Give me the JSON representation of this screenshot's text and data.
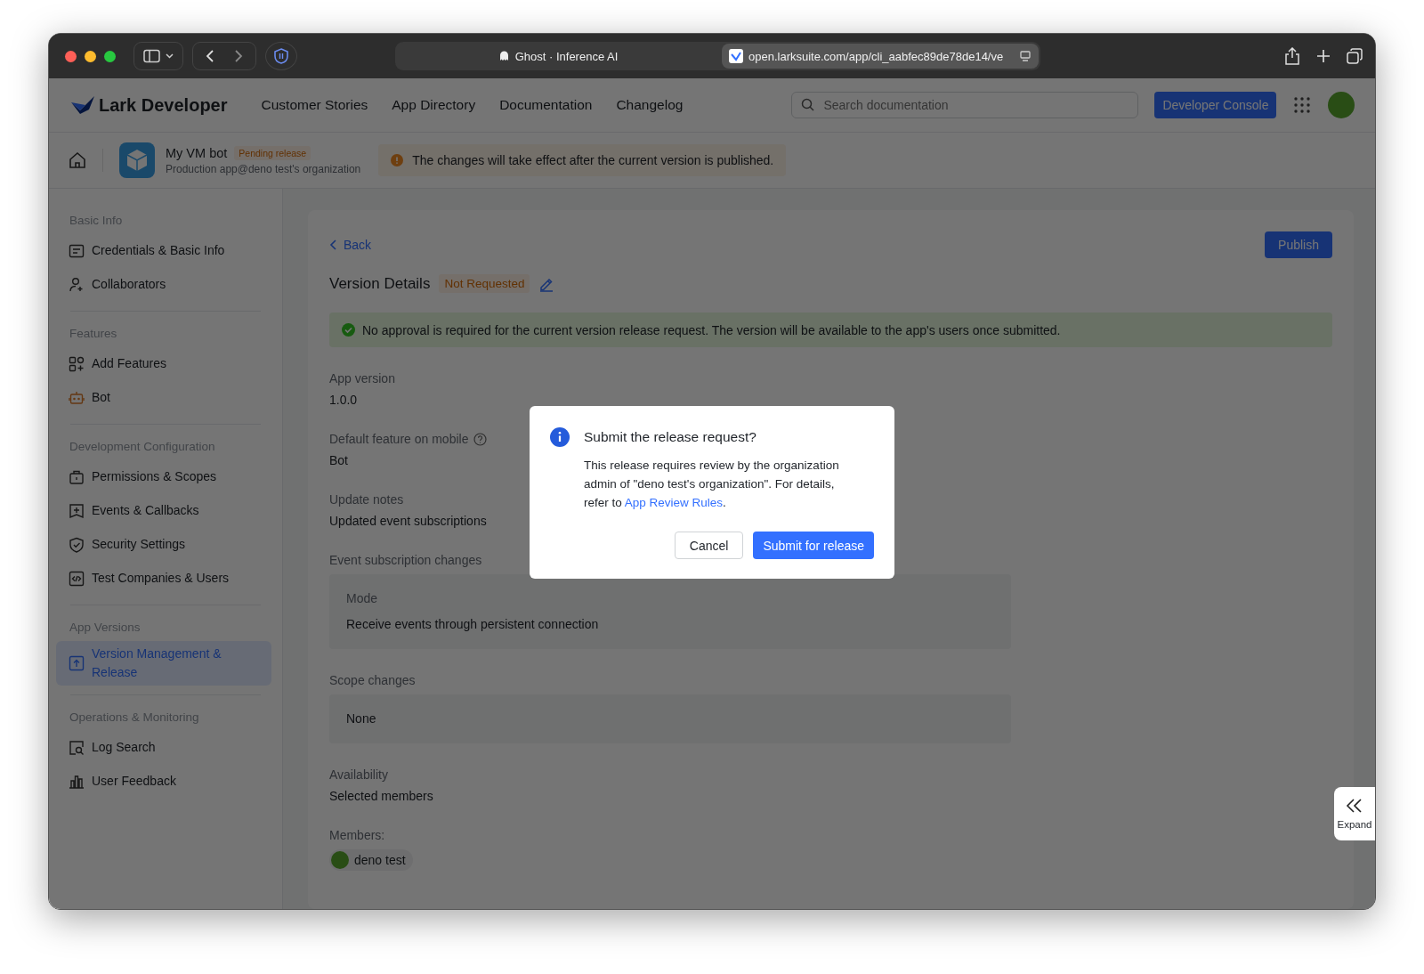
{
  "browser": {
    "tab_title": "Ghost · Inference AI",
    "url": "open.larksuite.com/app/cli_aabfec89de78de14/ve"
  },
  "nav": {
    "logo": "Lark Developer",
    "links": [
      "Customer Stories",
      "App Directory",
      "Documentation",
      "Changelog"
    ],
    "search": {
      "placeholder": "Search documentation"
    },
    "console_button": "Developer Console"
  },
  "app_header": {
    "name": "My VM bot",
    "badge": "Pending release",
    "subtitle": "Production app@deno test's organization",
    "notice": "The changes will take effect after the current version is published."
  },
  "sidebar": {
    "sections": [
      {
        "title": "Basic Info",
        "items": [
          {
            "label": "Credentials & Basic Info",
            "selected": false
          },
          {
            "label": "Collaborators",
            "selected": false
          }
        ]
      },
      {
        "title": "Features",
        "items": [
          {
            "label": "Add Features",
            "selected": false
          },
          {
            "label": "Bot",
            "selected": false
          }
        ]
      },
      {
        "title": "Development Configuration",
        "items": [
          {
            "label": "Permissions & Scopes",
            "selected": false
          },
          {
            "label": "Events & Callbacks",
            "selected": false
          },
          {
            "label": "Security Settings",
            "selected": false
          },
          {
            "label": "Test Companies & Users",
            "selected": false
          }
        ]
      },
      {
        "title": "App Versions",
        "items": [
          {
            "label": "Version Management & Release",
            "selected": true
          }
        ]
      },
      {
        "title": "Operations & Monitoring",
        "items": [
          {
            "label": "Log Search",
            "selected": false
          },
          {
            "label": "User Feedback",
            "selected": false
          }
        ]
      }
    ]
  },
  "main": {
    "back": "Back",
    "publish_button": "Publish",
    "title": "Version Details",
    "status": "Not Requested",
    "banner": "No approval is required for the current version release request. The version will be available to the app's users once submitted.",
    "fields": [
      {
        "kind": "text",
        "label": "App version",
        "value": "1.0.0"
      },
      {
        "kind": "text",
        "label": "Default feature on mobile",
        "value": "Bot",
        "help": true
      },
      {
        "kind": "text",
        "label": "Update notes",
        "value": "Updated event subscriptions"
      },
      {
        "kind": "box",
        "label": "Event subscription changes",
        "box_label": "Mode",
        "value": "Receive events through persistent connection"
      },
      {
        "kind": "box",
        "label": "Scope changes",
        "value": "None"
      },
      {
        "kind": "text",
        "label": "Availability",
        "value": "Selected members"
      },
      {
        "kind": "members",
        "label": "Members:",
        "value": "deno test"
      }
    ]
  },
  "dialog": {
    "title": "Submit the release request?",
    "body_before": "This release requires review by the organization admin of \"deno test's organization\". For details, refer to ",
    "link": "App Review Rules",
    "body_after": ".",
    "cancel": "Cancel",
    "confirm": "Submit for release"
  },
  "expand": "Expand"
}
